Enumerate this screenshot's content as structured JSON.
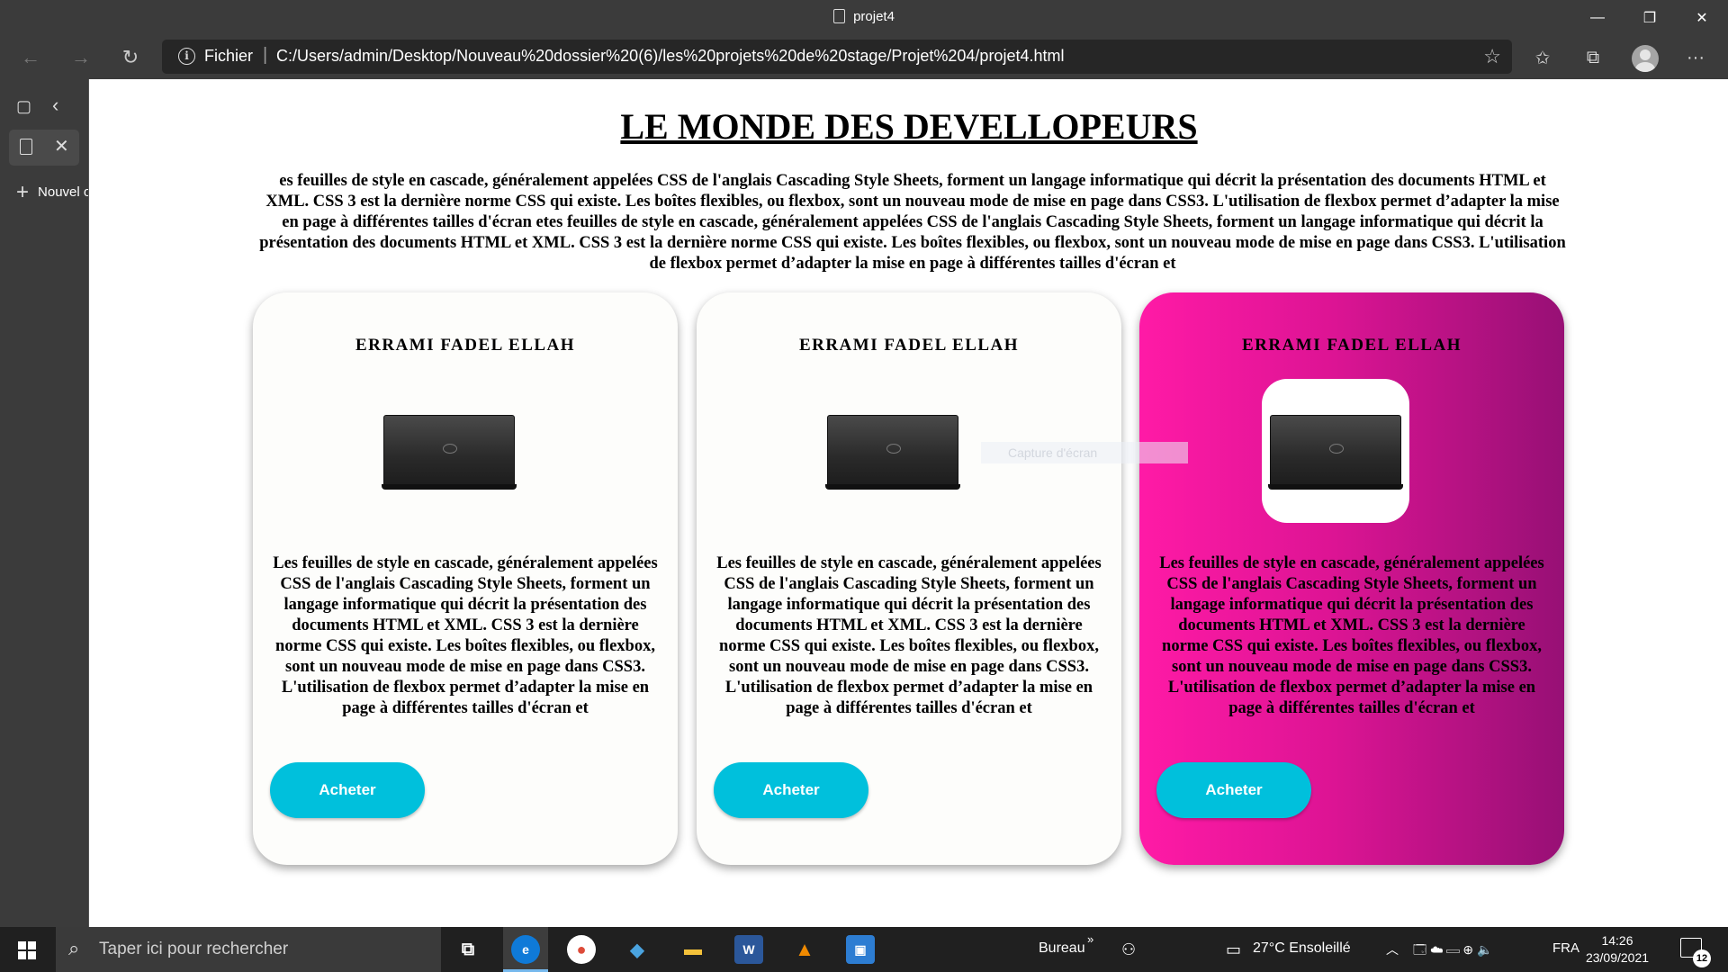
{
  "window": {
    "title": "projet4",
    "minimize_glyph": "—",
    "maximize_glyph": "❐",
    "close_glyph": "✕"
  },
  "toolbar": {
    "back_glyph": "←",
    "forward_glyph": "→",
    "refresh_glyph": "↻",
    "scheme_label": "Fichier",
    "separator": "|",
    "url": "C:/Users/admin/Desktop/Nouveau%20dossier%20(6)/les%20projets%20de%20stage/Projet%204/projet4.html",
    "info_glyph": "i",
    "add_favorite_glyph": "☆",
    "favorites_glyph": "✩",
    "collections_glyph": "⧉",
    "menu_glyph": "···"
  },
  "sidebar": {
    "tab_actions_glyph": "▢",
    "collapse_glyph": "‹",
    "close_tab_glyph": "✕",
    "new_tab_plus": "+",
    "new_tab_label": "Nouvel onglet"
  },
  "page": {
    "heading": "LE MONDE DES DEVELLOPEURS",
    "intro": "es feuilles de style en cascade, généralement appelées CSS de l'anglais Cascading Style Sheets, forment un langage informatique qui décrit la présentation des documents HTML et XML. CSS 3 est la dernière norme CSS qui existe. Les boîtes flexibles, ou flexbox, sont un nouveau mode de mise en page dans CSS3. L'utilisation de flexbox permet d’adapter la mise en page à différentes tailles d'écran etes feuilles de style en cascade, généralement appelées CSS de l'anglais Cascading Style Sheets, forment un langage informatique qui décrit la présentation des documents HTML et XML. CSS 3 est la dernière norme CSS qui existe. Les boîtes flexibles, ou flexbox, sont un nouveau mode de mise en page dans CSS3. L'utilisation de flexbox permet d’adapter la mise en page à différentes tailles d'écran et",
    "cards": [
      {
        "title": "ERRAMI FADEL ELLAH",
        "description": "Les feuilles de style en cascade, généralement appelées CSS de l'anglais Cascading Style Sheets, forment un langage informatique qui décrit la présentation des documents HTML et XML. CSS 3 est la dernière norme CSS qui existe. Les boîtes flexibles, ou flexbox, sont un nouveau mode de mise en page dans CSS3. L'utilisation de flexbox permet d’adapter la mise en page à différentes tailles d'écran et",
        "button": "Acheter",
        "image_icon": "laptop-icon"
      },
      {
        "title": "ERRAMI FADEL ELLAH",
        "description": "Les feuilles de style en cascade, généralement appelées CSS de l'anglais Cascading Style Sheets, forment un langage informatique qui décrit la présentation des documents HTML et XML. CSS 3 est la dernière norme CSS qui existe. Les boîtes flexibles, ou flexbox, sont un nouveau mode de mise en page dans CSS3. L'utilisation de flexbox permet d’adapter la mise en page à différentes tailles d'écran et",
        "button": "Acheter",
        "image_icon": "laptop-icon"
      },
      {
        "title": "ERRAMI FADEL ELLAH",
        "description": "Les feuilles de style en cascade, généralement appelées CSS de l'anglais Cascading Style Sheets, forment un langage informatique qui décrit la présentation des documents HTML et XML. CSS 3 est la dernière norme CSS qui existe. Les boîtes flexibles, ou flexbox, sont un nouveau mode de mise en page dans CSS3. L'utilisation de flexbox permet d’adapter la mise en page à différentes tailles d'écran et",
        "button": "Acheter",
        "image_icon": "laptop-icon"
      }
    ],
    "capture_ghost": "Capture d'écran"
  },
  "taskbar": {
    "search_placeholder": "Taper ici pour rechercher",
    "search_glyph": "⌕",
    "task_view_glyph": "⧉",
    "apps": [
      {
        "name": "edge",
        "glyph": "e",
        "color": "#0f7ad8"
      },
      {
        "name": "chrome",
        "glyph": "●",
        "color": "#dd4b39"
      },
      {
        "name": "app",
        "glyph": "◆",
        "color": "#4aa3df"
      },
      {
        "name": "explorer",
        "glyph": "▬",
        "color": "#f3c13a"
      },
      {
        "name": "word",
        "glyph": "W",
        "color": "#2b579a"
      },
      {
        "name": "vlc",
        "glyph": "▲",
        "color": "#f08a00"
      },
      {
        "name": "photos",
        "glyph": "▣",
        "color": "#2d7dd2"
      }
    ],
    "desktop_label": "Bureau",
    "desktop_chevron": "»",
    "people_glyph": "⚇",
    "weather": "27°C  Ensoleillé",
    "weather_glyph": "▭",
    "tray_up_glyph": "︿",
    "tray_icons": "🗔  ☁  ▭  ⊕  🔈",
    "language": "FRA",
    "time": "14:26",
    "date": "23/09/2021",
    "notifications_count": "12",
    "colors": {
      "accent": "#76b9ed",
      "buy_button": "#00c0dc",
      "pink_start": "#ff1aa6",
      "pink_end": "#971075"
    }
  }
}
